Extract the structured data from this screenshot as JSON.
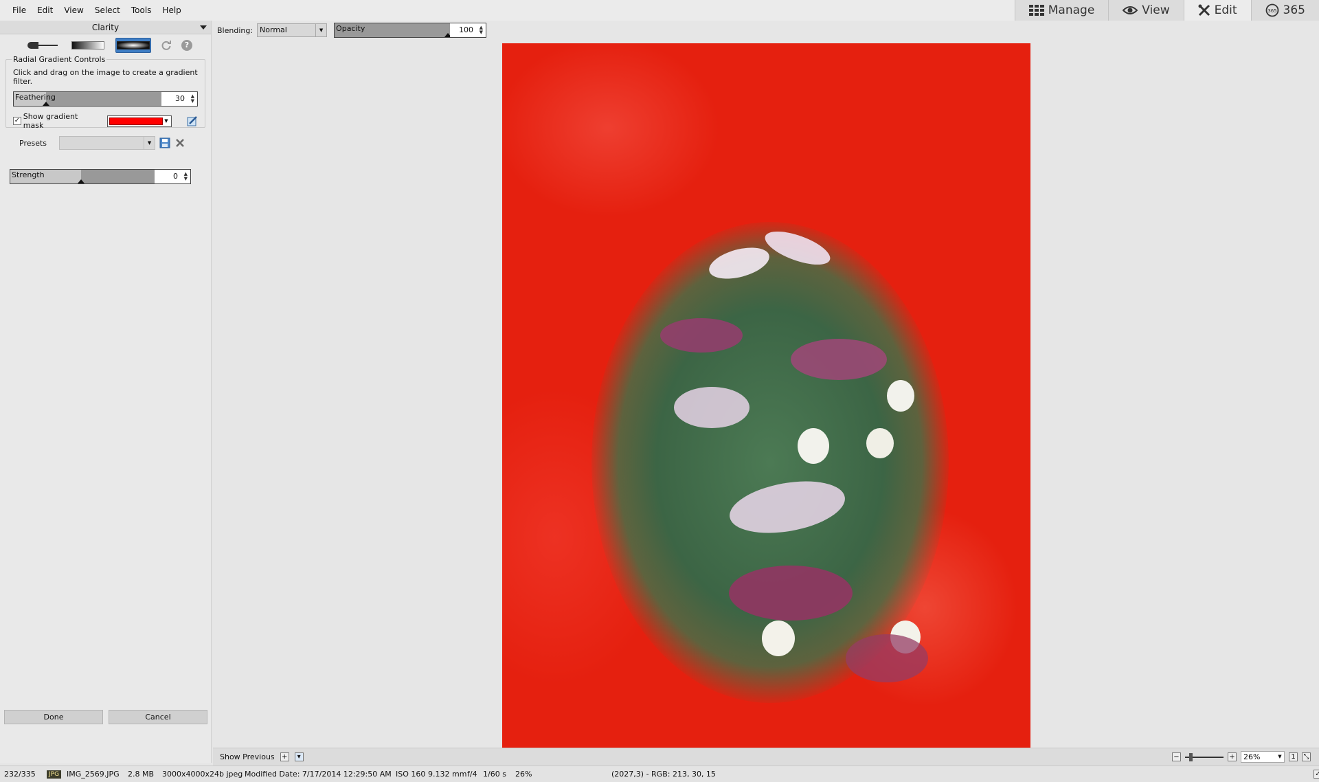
{
  "menu": [
    "File",
    "Edit",
    "View",
    "Select",
    "Tools",
    "Help"
  ],
  "modes": [
    {
      "label": "Manage",
      "icon": "grid-icon"
    },
    {
      "label": "View",
      "icon": "eye-icon"
    },
    {
      "label": "Edit",
      "icon": "tools-icon"
    },
    {
      "label": "365",
      "icon": "calendar-365-icon"
    }
  ],
  "panel": {
    "title": "Clarity",
    "group_title": "Radial Gradient Controls",
    "group_desc": "Click and drag on the image to create a gradient filter.",
    "feathering": {
      "label": "Feathering",
      "value": "30",
      "fraction": 0.3
    },
    "show_mask_label": "Show gradient mask",
    "mask_color": "#ff0000",
    "presets_label": "Presets",
    "strength": {
      "label": "Strength",
      "value": "0",
      "fraction": 0.5
    },
    "done_label": "Done",
    "cancel_label": "Cancel"
  },
  "toolbar": {
    "blending_label": "Blending:",
    "blending_value": "Normal",
    "opacity": {
      "label": "Opacity",
      "value": "100",
      "fraction": 1.0
    }
  },
  "bottombar": {
    "show_previous": "Show Previous",
    "zoom": "26%"
  },
  "status": {
    "index": "232/335",
    "format": "JPG",
    "filename": "IMG_2569.JPG",
    "filesize": "2.8 MB",
    "dimensions": "3000x4000x24b jpeg",
    "modified": "Modified Date: 7/17/2014 12:29:50 AM",
    "iso": "ISO 160",
    "focal": "9.132 mm",
    "aperture": "f/4",
    "shutter": "1/60 s",
    "zoom": "26%",
    "pixel": "(2027,3) - RGB: 213, 30, 15"
  }
}
